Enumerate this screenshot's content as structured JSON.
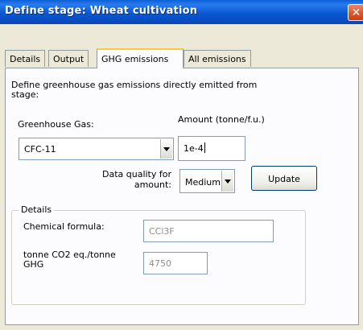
{
  "window": {
    "title": "Define stage: Wheat cultivation",
    "close_symbol": "✕"
  },
  "tabs": [
    {
      "label": "Details",
      "active": false
    },
    {
      "label": "Output",
      "active": false
    },
    {
      "label": "GHG emissions",
      "active": true
    },
    {
      "label": "All emissions",
      "active": false
    }
  ],
  "ghg": {
    "intro_line1": "Define greenhouse gas emissions directly emitted  from",
    "intro_line2": "stage:",
    "gas_label": "Greenhouse Gas:",
    "gas_value": "CFC-11",
    "amount_label": "Amount (tonne/f.u.)",
    "amount_value": "1e-4",
    "quality_label_line1": "Data quality for",
    "quality_label_line2": "amount:",
    "quality_value": "Medium",
    "update_label": "Update"
  },
  "details": {
    "legend": "Details",
    "formula_label": "Chemical formula:",
    "formula_value": "CCl3F",
    "co2eq_label_line1": "tonne CO2 eq./tonne",
    "co2eq_label_line2": "GHG",
    "co2eq_value": "4750"
  }
}
